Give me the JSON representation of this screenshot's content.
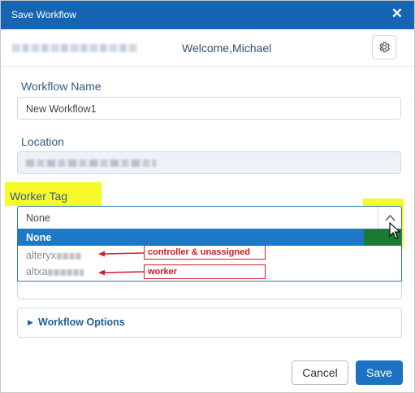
{
  "dialog": {
    "title": "Save Workflow",
    "close_glyph": "✕"
  },
  "header": {
    "welcome_text": "Welcome,Michael",
    "settings_icon": "gear-icon"
  },
  "workflow_name": {
    "label": "Workflow Name",
    "value": "New Workflow1"
  },
  "location": {
    "label": "Location"
  },
  "worker_tag": {
    "label": "Worker Tag",
    "selected": "None",
    "options": [
      {
        "label": "None"
      },
      {
        "label": "alteryx"
      },
      {
        "label": "altxa"
      }
    ]
  },
  "annotations": {
    "controller": "controller & unassigned",
    "worker": "worker",
    "color": "#cf1b25"
  },
  "workflow_options": {
    "label": "Workflow Options"
  },
  "buttons": {
    "cancel": "Cancel",
    "save": "Save"
  },
  "colors": {
    "titlebar": "#1565b3",
    "primary": "#1b73c1",
    "highlight": "#f8f92a",
    "selected_option": "#1d79c6"
  }
}
